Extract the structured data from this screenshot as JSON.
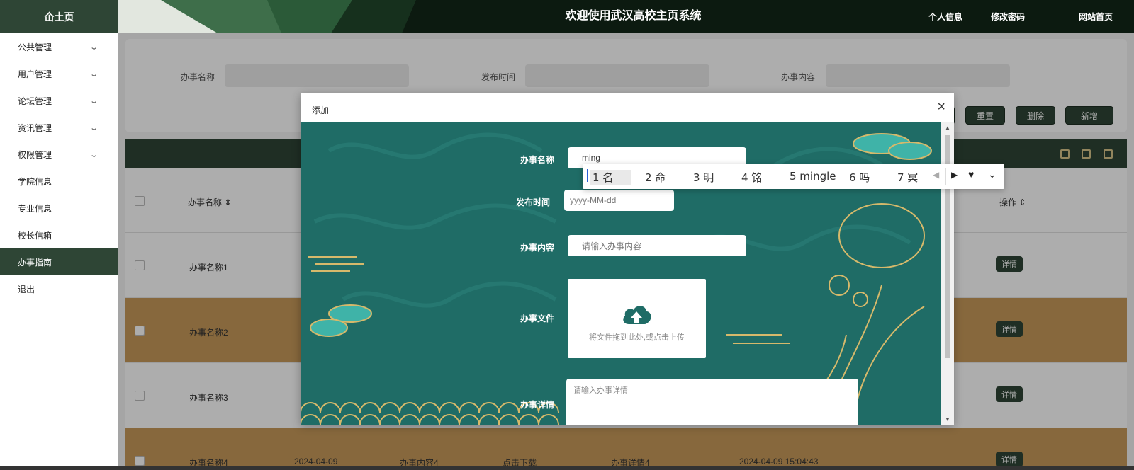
{
  "sidebar": {
    "brand": "仚土页",
    "items": [
      {
        "label": "公共管理",
        "chevron": true
      },
      {
        "label": "用户管理",
        "chevron": true
      },
      {
        "label": "论坛管理",
        "chevron": true
      },
      {
        "label": "资讯管理",
        "chevron": true
      },
      {
        "label": "权限管理",
        "chevron": true
      },
      {
        "label": "学院信息",
        "chevron": false
      },
      {
        "label": "专业信息",
        "chevron": false
      },
      {
        "label": "校长信箱",
        "chevron": false
      },
      {
        "label": "办事指南",
        "chevron": false,
        "active": true
      },
      {
        "label": "退出",
        "chevron": false
      }
    ]
  },
  "header": {
    "title": "欢迎使用武汉高校主页系统",
    "links": [
      "个人信息",
      "修改密码",
      "网站首页"
    ]
  },
  "search": {
    "labels": [
      "办事名称",
      "发布时间",
      "办事内容"
    ],
    "buttons": [
      "重置",
      "删除",
      "新增"
    ]
  },
  "table": {
    "headers": {
      "name": "办事名称",
      "actions": "操作"
    },
    "rows": [
      {
        "name": "办事名称1",
        "detail": "详情"
      },
      {
        "name": "办事名称2",
        "detail": "详情"
      },
      {
        "name": "办事名称3",
        "detail": "详情"
      },
      {
        "name": "办事名称4",
        "date": "2024-04-09",
        "content": "办事内容4",
        "file": "点击下载",
        "info": "办事详情4",
        "time": "2024-04-09 15:04:43",
        "detail": "详情"
      }
    ]
  },
  "dialog": {
    "title": "添加",
    "close": "×",
    "fields": {
      "name_label": "办事名称",
      "name_value": "ming",
      "date_label": "发布时间",
      "date_placeholder": "yyyy-MM-dd",
      "content_label": "办事内容",
      "content_placeholder": "请输入办事内容",
      "file_label": "办事文件",
      "upload_text": "将文件拖到此处,或点击上传",
      "detail_label": "办事详情",
      "detail_placeholder": "请输入办事详情"
    }
  },
  "ime": {
    "candidates": [
      "1 名",
      "2 命",
      "3 明",
      "4 铭",
      "5 mingle",
      "6 吗",
      "7 冥"
    ]
  },
  "colors": {
    "primary": "#2e4535",
    "row_alt": "#c89a5a",
    "dialog_bg": "#1f6c66"
  }
}
